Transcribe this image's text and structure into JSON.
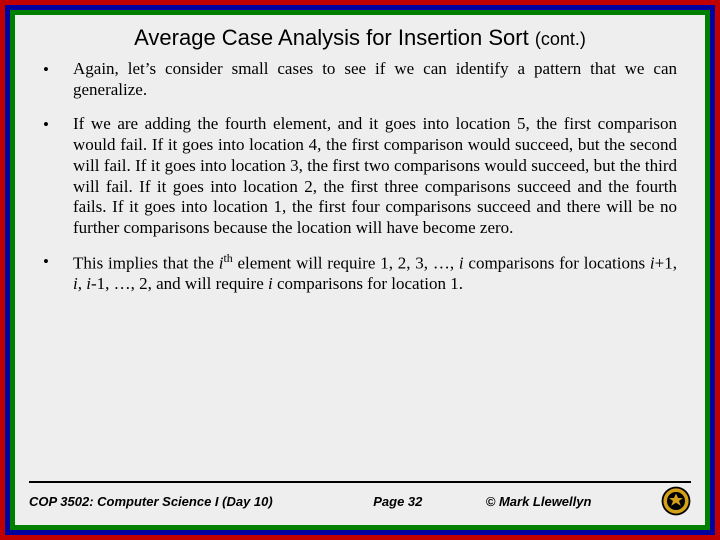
{
  "title": {
    "main": "Average Case Analysis for Insertion Sort",
    "cont": "(cont.)"
  },
  "bullets": [
    "Again, let’s consider small cases to see if we can identify a pattern that we can generalize.",
    "If we are adding the fourth element, and it goes into location 5, the first comparison would fail.  If it goes into location 4, the first comparison would succeed, but the second will fail.  If it goes into location 3, the first two comparisons would succeed, but the third will fail.  If it goes into location 2, the first three comparisons succeed and the fourth fails.  If it goes into location 1, the first four comparisons succeed and there will be no further comparisons because the location will have become zero.",
    "This implies that the <span class=\"ith-i\">i</span><sup>th</sup> element will require 1, 2, 3, …, <span class=\"ith-i\">i</span> comparisons for locations <span class=\"ith-i\">i</span>+1, <span class=\"ith-i\">i</span>, <span class=\"ith-i\">i</span>-1, …, 2, and will require <span class=\"ith-i\">i</span> comparisons for location 1."
  ],
  "footer": {
    "course": "COP 3502: Computer Science I  (Day 10)",
    "page": "Page 32",
    "author": "© Mark Llewellyn"
  }
}
